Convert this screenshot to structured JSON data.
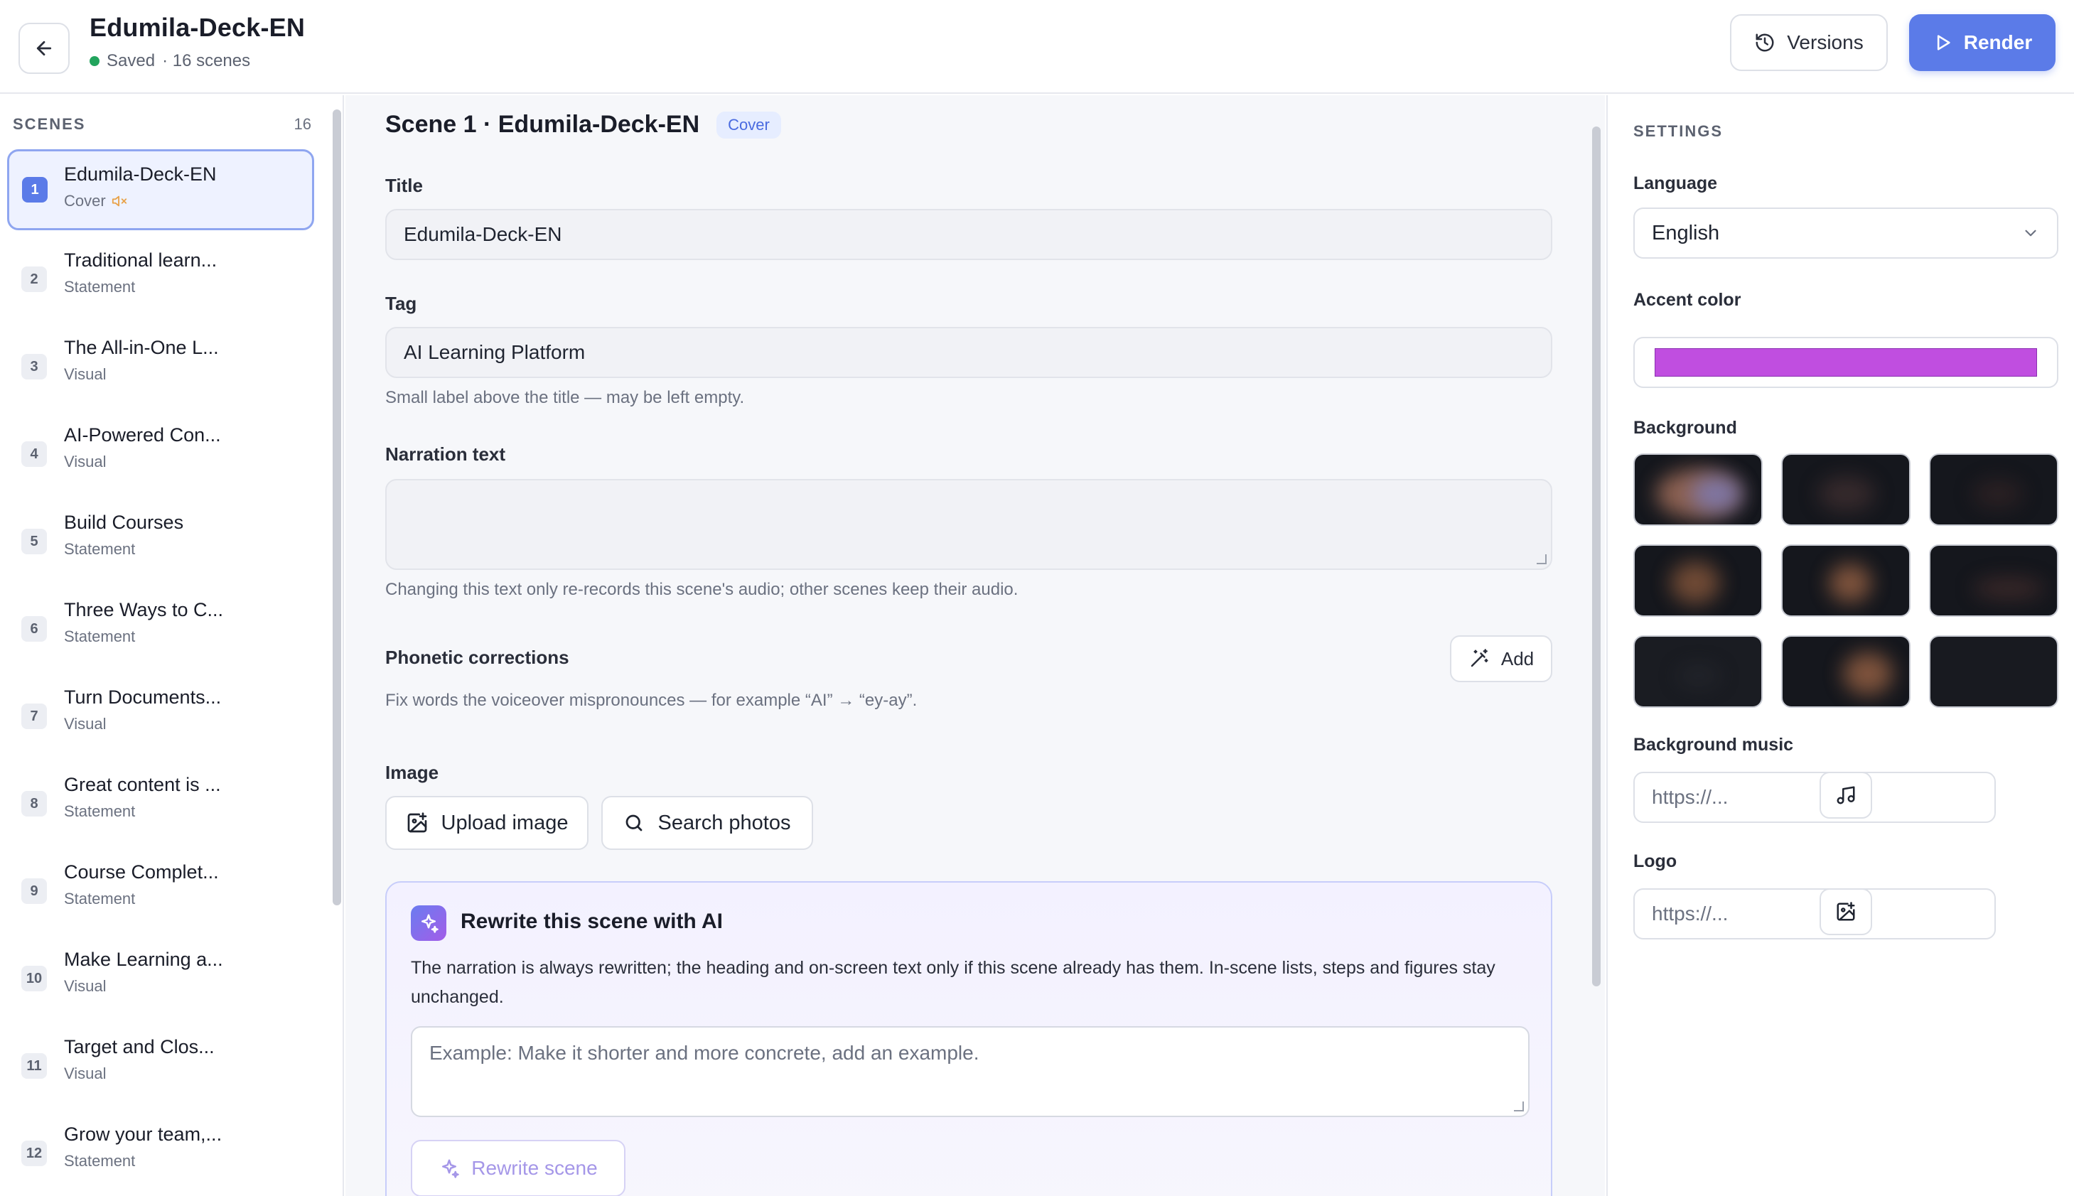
{
  "header": {
    "title": "Edumila-Deck-EN",
    "status": "Saved",
    "scene_count_text": "· 16 scenes",
    "versions_label": "Versions",
    "render_label": "Render"
  },
  "sidebar": {
    "heading": "SCENES",
    "count": "16",
    "scenes": [
      {
        "num": "1",
        "title": "Edumila-Deck-EN",
        "type": "Cover"
      },
      {
        "num": "2",
        "title": "Traditional learn...",
        "type": "Statement"
      },
      {
        "num": "3",
        "title": "The All-in-One L...",
        "type": "Visual"
      },
      {
        "num": "4",
        "title": "AI-Powered Con...",
        "type": "Visual"
      },
      {
        "num": "5",
        "title": "Build Courses",
        "type": "Statement"
      },
      {
        "num": "6",
        "title": "Three Ways to C...",
        "type": "Statement"
      },
      {
        "num": "7",
        "title": "Turn Documents...",
        "type": "Visual"
      },
      {
        "num": "8",
        "title": "Great content is ...",
        "type": "Statement"
      },
      {
        "num": "9",
        "title": "Course Complet...",
        "type": "Statement"
      },
      {
        "num": "10",
        "title": "Make Learning a...",
        "type": "Visual"
      },
      {
        "num": "11",
        "title": "Target and Clos...",
        "type": "Visual"
      },
      {
        "num": "12",
        "title": "Grow your team,...",
        "type": "Statement"
      }
    ]
  },
  "editor": {
    "scene_heading": "Scene 1 · Edumila-Deck-EN",
    "badge": "Cover",
    "title_label": "Title",
    "title_value": "Edumila-Deck-EN",
    "tag_label": "Tag",
    "tag_value": "AI Learning Platform",
    "tag_hint": "Small label above the title — may be left empty.",
    "narration_label": "Narration text",
    "narration_hint": "Changing this text only re-records this scene's audio; other scenes keep their audio.",
    "phonetic_label": "Phonetic corrections",
    "phonetic_add": "Add",
    "phonetic_hint": "Fix words the voiceover mispronounces — for example “AI” → “ey-ay”.",
    "image_label": "Image",
    "upload_label": "Upload image",
    "search_label": "Search photos"
  },
  "ai_rewrite": {
    "title": "Rewrite this scene with AI",
    "description": "The narration is always rewritten; the heading and on-screen text only if this scene already has them. In-scene lists, steps and figures stay unchanged.",
    "placeholder": "Example: Make it shorter and more concrete, add an example.",
    "button_label": "Rewrite scene"
  },
  "settings": {
    "heading": "SETTINGS",
    "language_label": "Language",
    "language_value": "English",
    "accent_label": "Accent color",
    "accent_color": "#c04ee0",
    "background_label": "Background",
    "music_label": "Background music",
    "music_placeholder": "https://...",
    "logo_label": "Logo",
    "logo_placeholder": "https://..."
  },
  "colors": {
    "primary": "#5b7be8",
    "saved_dot": "#22a45d",
    "muted_icon": "#e8a24a"
  }
}
